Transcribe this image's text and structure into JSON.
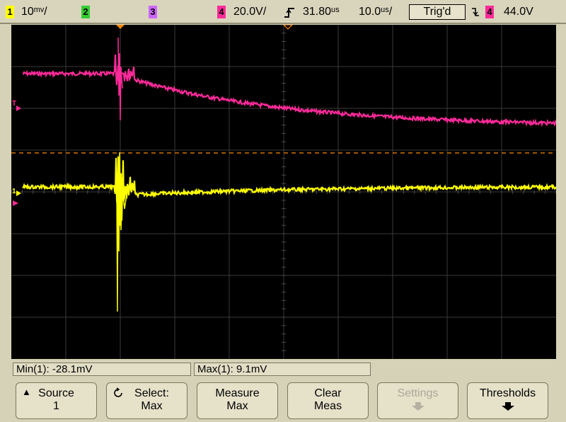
{
  "topbar": {
    "ch1_label": "1",
    "ch1_scale": "10ᵐᵛ/",
    "ch2_label": "2",
    "ch3_label": "3",
    "ch4_label": "4",
    "ch4_scale": "20.0V/",
    "trigger_icon": "trigger-edge-icon",
    "time_delay": "31.80ᵘˢ",
    "time_scale": "10.0ᵘˢ/",
    "status": "Trig'd",
    "slope_icon": "falling-slope-icon",
    "trig_source": "4",
    "trig_level": "44.0V"
  },
  "colors": {
    "ch1": "#ffff00",
    "ch2": "#33cc33",
    "ch3": "#cc66ff",
    "ch4": "#ff2a9a",
    "trigger_level_line": "#ff8800"
  },
  "measurements": {
    "min": "Min(1): -28.1mV",
    "max": "Max(1): 9.1mV"
  },
  "softkeys": [
    {
      "line1": "Source",
      "line2": "1",
      "icon": "up-arrow-icon"
    },
    {
      "line1": "Select:",
      "line2": "Max",
      "icon": "rotate-knob-icon"
    },
    {
      "line1": "Measure",
      "line2": "Max"
    },
    {
      "line1": "Clear",
      "line2": "Meas"
    },
    {
      "line1": "Settings",
      "line2": "",
      "icon": "down-arrow-icon",
      "disabled": true
    },
    {
      "line1": "Thresholds",
      "line2": "",
      "icon": "down-arrow-icon"
    }
  ],
  "markers": {
    "ch4_ground": "T",
    "ch1_ground": "1"
  }
}
